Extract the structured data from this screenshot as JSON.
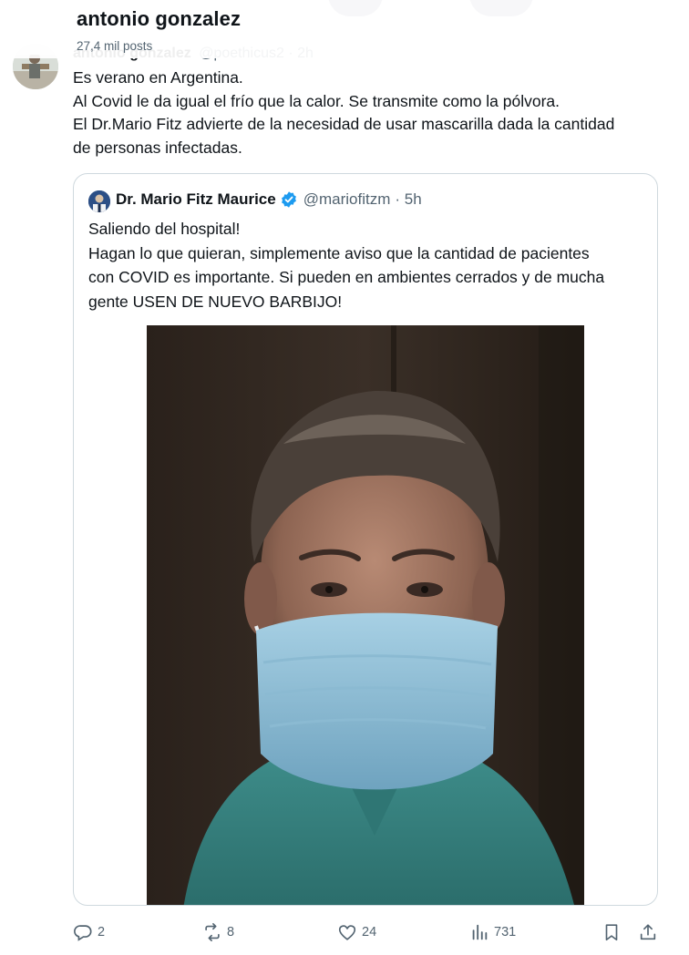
{
  "header": {
    "name": "antonio gonzalez",
    "post_count": "27,4 mil posts"
  },
  "tweet": {
    "author_name": "antonio gonzalez",
    "author_handle": "@poethicus2 · 2h",
    "lines": [
      "Es verano en Argentina.",
      "Al Covid le da igual el frío que la calor. Se transmite como la pólvora.",
      "El Dr.Mario Fitz advierte de la necesidad de usar mascarilla dada la cantidad",
      "de personas infectadas."
    ]
  },
  "quote": {
    "author_name": "Dr. Mario Fitz Maurice",
    "author_handle": "@mariofitzm",
    "time": "· 5h",
    "lines": [
      "Saliendo del hospital!",
      "Hagan lo que quieran, simplemente aviso que la cantidad de pacientes",
      "con COVID es importante. Si pueden en ambientes cerrados y de mucha",
      "gente USEN DE NUEVO BARBIJO!"
    ]
  },
  "actions": {
    "replies": "2",
    "reposts": "8",
    "likes": "24",
    "views": "731"
  },
  "icons": {
    "reply": "reply-icon",
    "repost": "repost-icon",
    "like": "heart-icon",
    "views": "views-icon",
    "bookmark": "bookmark-icon",
    "share": "share-icon",
    "verified": "verified-badge-icon"
  },
  "colors": {
    "text": "#0f1419",
    "muted": "#536471",
    "border": "#cfd9de",
    "verified": "#1d9bf0"
  }
}
